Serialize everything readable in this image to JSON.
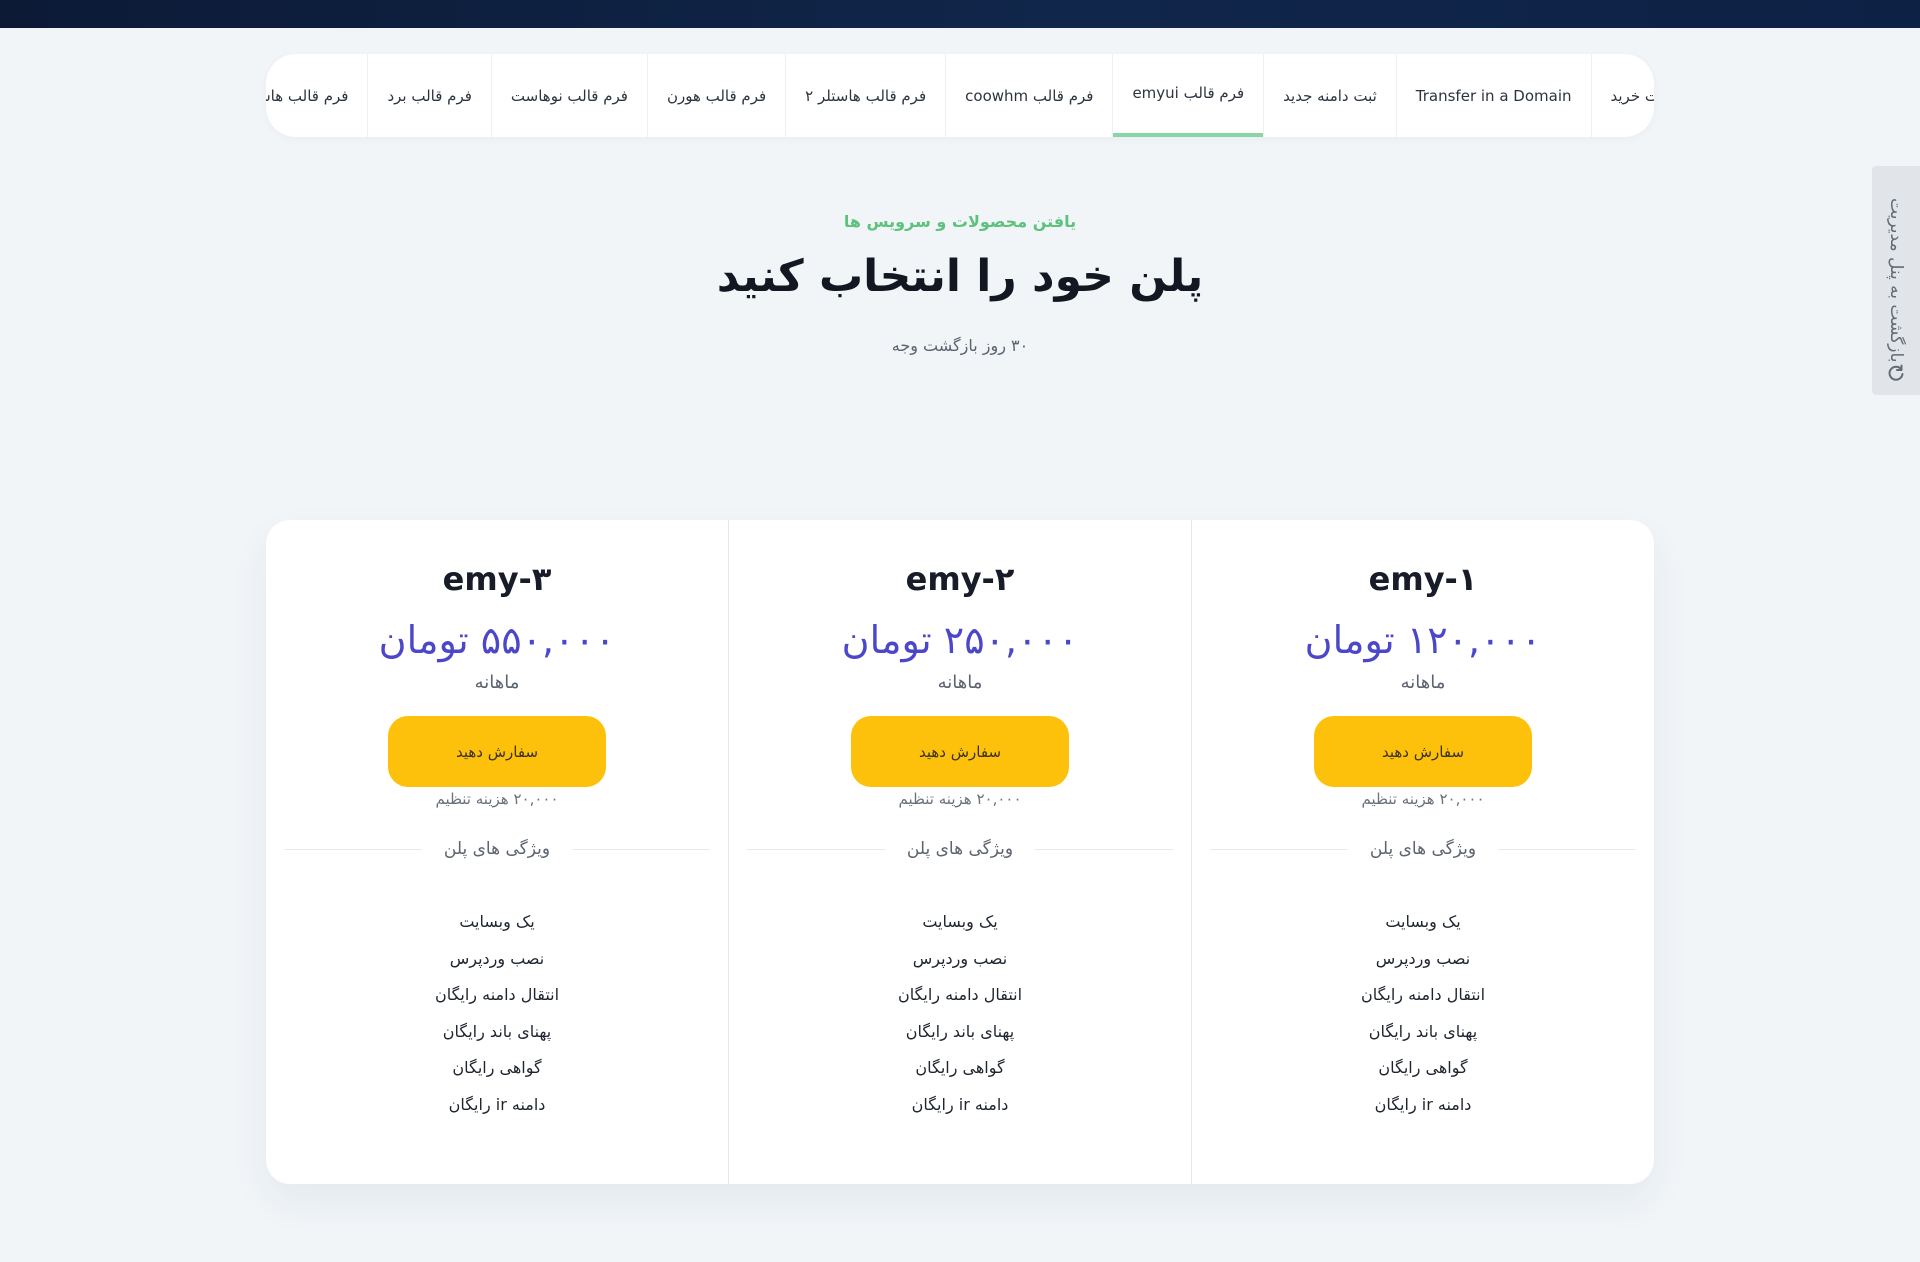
{
  "nav_tabs": [
    {
      "label": "ت خرید",
      "active": false
    },
    {
      "label": "Transfer in a Domain",
      "active": false
    },
    {
      "label": "ثبت دامنه جدید",
      "active": false
    },
    {
      "label": "فرم قالب emyui",
      "active": true
    },
    {
      "label": "فرم قالب coowhm",
      "active": false
    },
    {
      "label": "فرم قالب هاستلر ۲",
      "active": false
    },
    {
      "label": "فرم قالب هورن",
      "active": false
    },
    {
      "label": "فرم قالب نوهاست",
      "active": false
    },
    {
      "label": "فرم قالب برد",
      "active": false
    },
    {
      "label": "فرم قالب هاستلر",
      "active": false
    }
  ],
  "side_tab": {
    "label": "بازگشت به پنل مدیریت",
    "icon": "refresh-icon"
  },
  "header": {
    "eyebrow": "یافتن محصولات و سرویس ها",
    "title": "پلن خود را انتخاب کنید",
    "subtitle": "۳۰ روز بازگشت وجه"
  },
  "plans": [
    {
      "name": "emy-۱",
      "price": "۱۲۰,۰۰۰ تومان",
      "period": "ماهانه",
      "order_label": "سفارش دهید",
      "setup_fee": "۲۰,۰۰۰ هزینه تنظیم",
      "features_title": "ویژگی های پلن",
      "features": [
        "یک وبسایت",
        "نصب وردپرس",
        "انتقال دامنه رایگان",
        "پهنای باند رایگان",
        "گواهی رایگان",
        "دامنه ir رایگان"
      ]
    },
    {
      "name": "emy-۲",
      "price": "۲۵۰,۰۰۰ تومان",
      "period": "ماهانه",
      "order_label": "سفارش دهید",
      "setup_fee": "۲۰,۰۰۰ هزینه تنظیم",
      "features_title": "ویژگی های پلن",
      "features": [
        "یک وبسایت",
        "نصب وردپرس",
        "انتقال دامنه رایگان",
        "پهنای باند رایگان",
        "گواهی رایگان",
        "دامنه ir رایگان"
      ]
    },
    {
      "name": "emy-۳",
      "price": "۵۵۰,۰۰۰ تومان",
      "period": "ماهانه",
      "order_label": "سفارش دهید",
      "setup_fee": "۲۰,۰۰۰ هزینه تنظیم",
      "features_title": "ویژگی های پلن",
      "features": [
        "یک وبسایت",
        "نصب وردپرس",
        "انتقال دامنه رایگان",
        "پهنای باند رایگان",
        "گواهی رایگان",
        "دامنه ir رایگان"
      ]
    }
  ],
  "colors": {
    "accent_green": "#5ec27e",
    "price_purple": "#4c47c9",
    "button_yellow": "#fec10b",
    "topbar_navy": "#0c1a36"
  }
}
